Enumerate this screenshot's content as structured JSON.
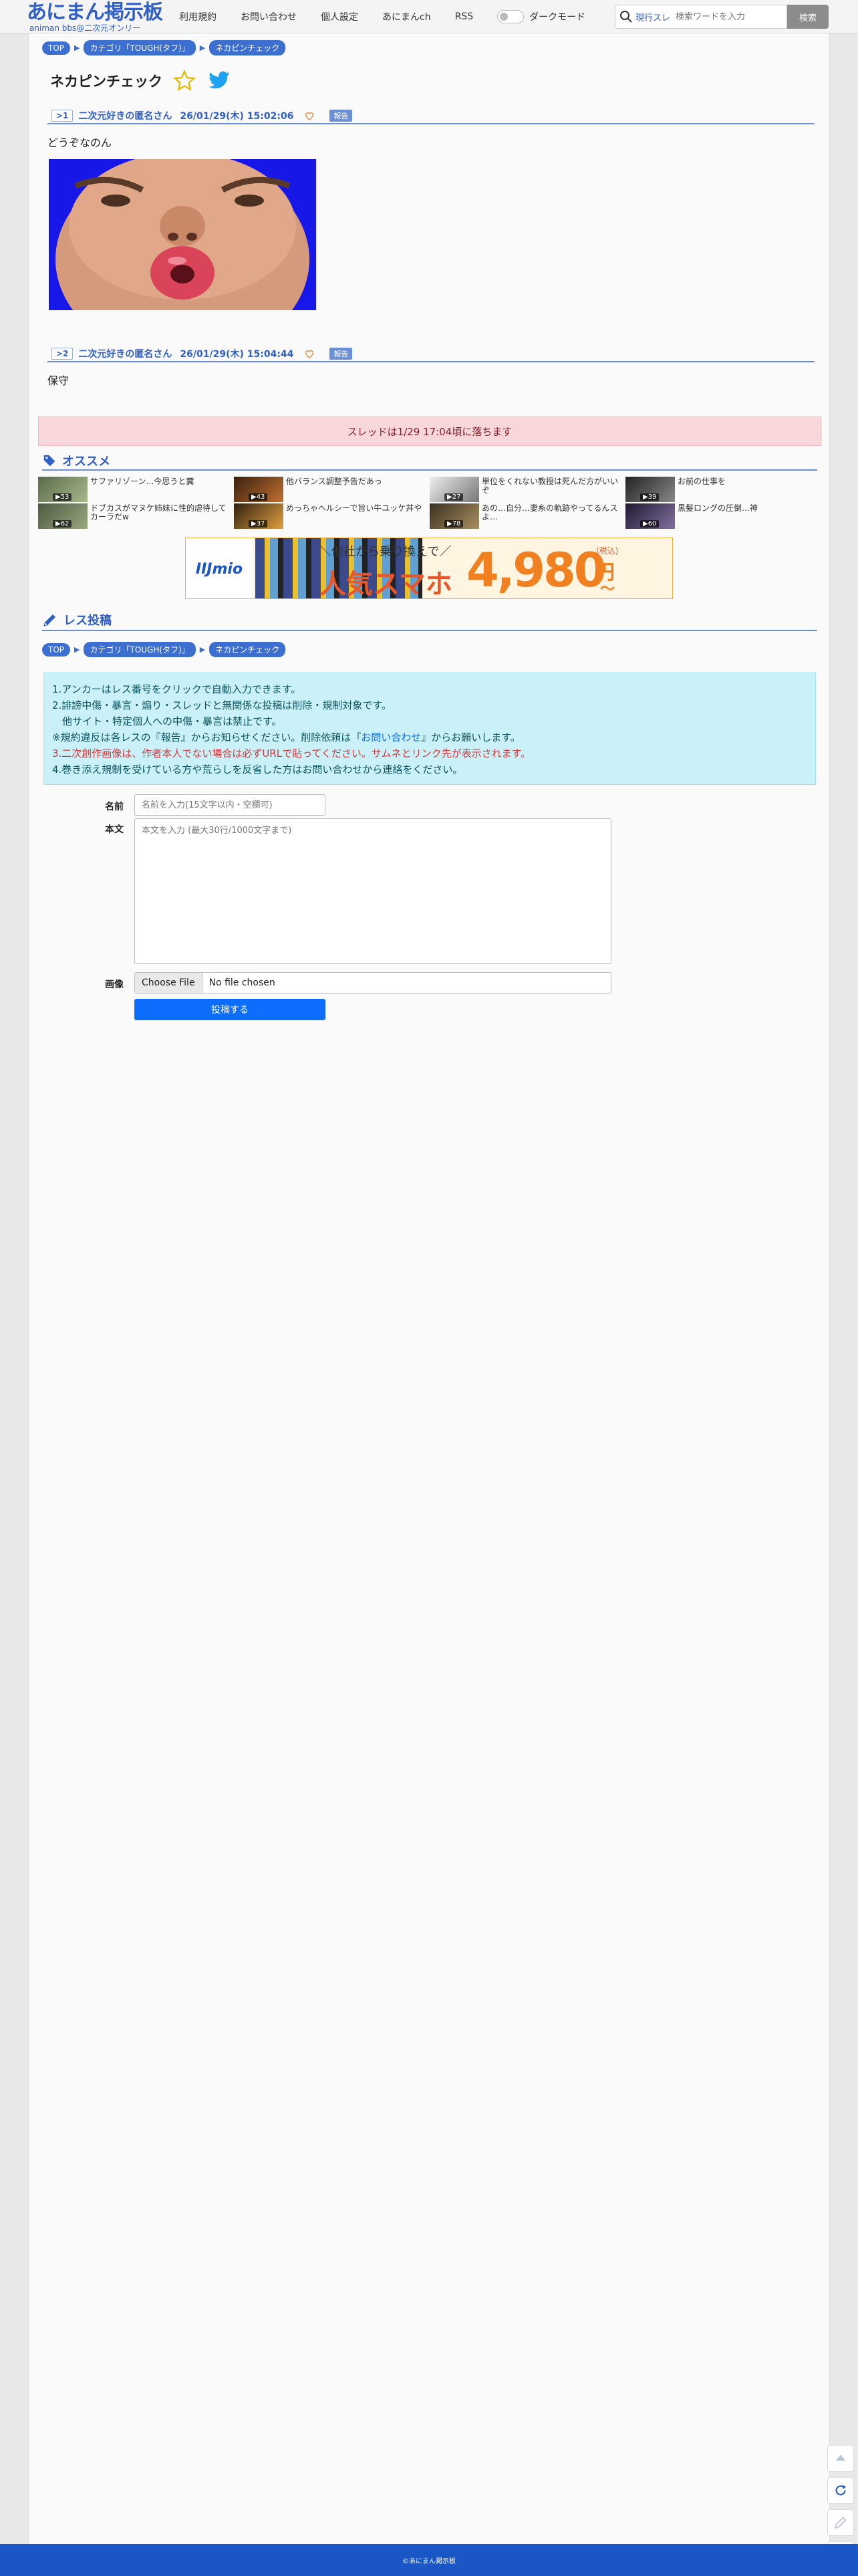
{
  "header": {
    "logo_text": "あにまん掲示板",
    "logo_sub": "animan bbs@二次元オンリー",
    "nav": [
      "利用規約",
      "お問い合わせ",
      "個人設定",
      "あにまんch",
      "RSS"
    ],
    "dark_mode_label": "ダークモード",
    "search_scope": "現行スレ",
    "search_placeholder": "検索ワードを入力",
    "search_button": "検索"
  },
  "breadcrumb": [
    "TOP",
    "カテゴリ「TOUGH(タフ)」",
    "ネカピンチェック"
  ],
  "thread": {
    "title": "ネカピンチェック",
    "posts": [
      {
        "no": ">1",
        "author": "二次元好きの匿名さん",
        "date": "26/01/29(木) 15:02:06",
        "report": "報告",
        "body": "どうぞなのん"
      },
      {
        "no": ">2",
        "author": "二次元好きの匿名さん",
        "date": "26/01/29(木) 15:04:44",
        "report": "報告",
        "body": "保守"
      }
    ],
    "expire_notice": "スレッドは1/29 17:04頃に落ちます"
  },
  "recommend": {
    "title": "オススメ",
    "items": [
      {
        "text": "サファリゾーン…今思うと糞",
        "count": "▶53"
      },
      {
        "text": "他バランス調整予告だあっ",
        "count": "▶43"
      },
      {
        "text": "単位をくれない教授は死んだ方がいいぞ",
        "count": "▶27"
      },
      {
        "text": "お前の仕事を",
        "count": "▶39"
      },
      {
        "text": "ドブカスがマヌケ姉妹に性的虐待してカーラだw",
        "count": "▶62"
      },
      {
        "text": "めっちゃヘルシーで旨い牛ユッケ丼や",
        "count": "▶37"
      },
      {
        "text": "あの…自分…妻糸の軌跡やってるんスよ…",
        "count": "▶78"
      },
      {
        "text": "黒髪ロングの圧倒…神",
        "count": "▶60"
      }
    ]
  },
  "ad": {
    "brand": "IIJmio",
    "top": "＼他社から乗り換えで／",
    "main": "人気スマホ",
    "price": "4,980",
    "yen": "円",
    "tax": "(税込)",
    "suffix": "〜"
  },
  "reply": {
    "title": "レス投稿",
    "rules": [
      "1.アンカーはレス番号をクリックで自動入力できます。",
      "2.誹謗中傷・暴言・煽り・スレッドと無関係な投稿は削除・規制対象です。",
      "　他サイト・特定個人への中傷・暴言は禁止です。",
      "※規約違反は各レスの『報告』からお知らせください。削除依頼は『",
      "お問い合わせ",
      "』からお願いします。",
      "3.二次創作画像は、作者本人でない場合は必ずURLで貼ってください。サムネとリンク先が表示されます。",
      "4.巻き添え規制を受けている方や荒らしを反省した方はお問い合わせから連絡をください。"
    ],
    "name_label": "名前",
    "name_placeholder": "名前を入力(15文字以内・空欄可)",
    "body_label": "本文",
    "body_placeholder": "本文を入力 (最大30行/1000文字まで)",
    "image_label": "画像",
    "file_button": "Choose File",
    "file_status": "No file chosen",
    "submit": "投稿する"
  },
  "footer": {
    "text": "©あにまん掲示板"
  },
  "colors": {
    "accent": "#2e5ec6",
    "crumb": "#3d6fd1",
    "footer": "#1a56c5",
    "notice_bg": "#f8d7da",
    "rules_bg": "#c9f1f7"
  }
}
